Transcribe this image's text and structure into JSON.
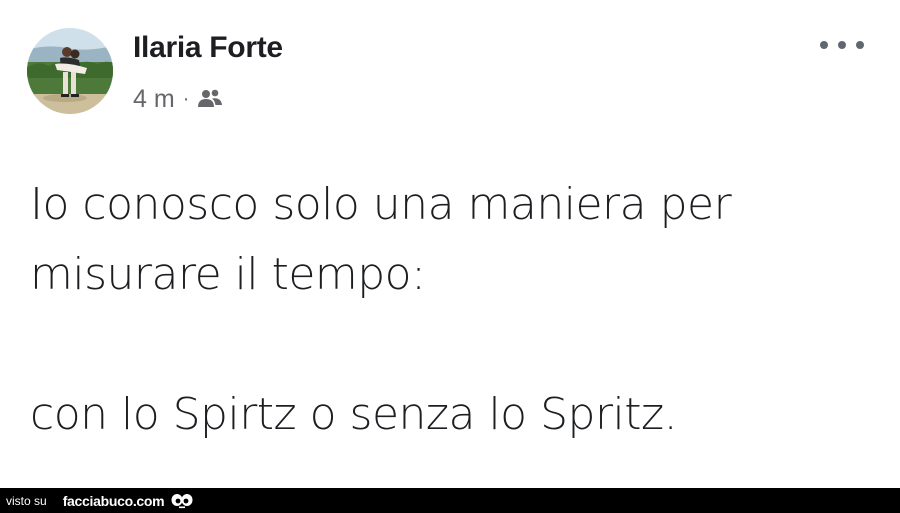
{
  "post": {
    "author": "Ilaria Forte",
    "time": "4 m",
    "separator": "·",
    "audience_icon": "friends-icon",
    "more_icon": "more-options-icon",
    "text_lines": [
      "Io conosco solo una maniera per",
      "misurare il tempo:",
      "con lo Spirtz o senza lo Spritz."
    ]
  },
  "watermark": {
    "prefix": "visto su",
    "site": "facciabuco.com",
    "logo_icon": "eyes-logo-icon"
  },
  "colors": {
    "background": "#ffffff",
    "text": "#1c1e21",
    "meta": "#65676b",
    "watermark_bar": "#000000"
  }
}
